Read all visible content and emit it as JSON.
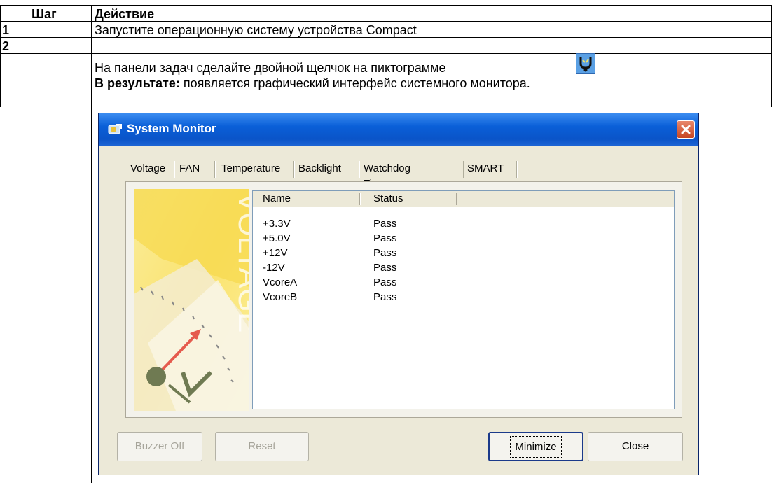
{
  "table": {
    "header": {
      "step": "Шаг",
      "action": "Действие"
    },
    "rows": [
      {
        "step": "1",
        "text": "Запустите операционную систему устройства Compact"
      },
      {
        "step": "2",
        "line1": "На панели задач сделайте двойной щелчок на пиктограмме",
        "result_label": "В результате:",
        "result_text": "появляется графический интерфейс системного монитора."
      }
    ]
  },
  "window": {
    "title": "System Monitor",
    "tabs": [
      "Voltage",
      "FAN",
      "Temperature",
      "Backlight",
      "Watchdog Timer",
      "SMART"
    ],
    "active_tab": "Voltage",
    "art_label": "VOLTAGE",
    "list": {
      "columns": [
        "Name",
        "Status"
      ],
      "rows": [
        {
          "name": "+3.3V",
          "status": "Pass"
        },
        {
          "name": "+5.0V",
          "status": "Pass"
        },
        {
          "name": "+12V",
          "status": "Pass"
        },
        {
          "name": "-12V",
          "status": "Pass"
        },
        {
          "name": "VcoreA",
          "status": "Pass"
        },
        {
          "name": "VcoreB",
          "status": "Pass"
        }
      ]
    },
    "buttons": {
      "buzzer_off": "Buzzer Off",
      "reset": "Reset",
      "minimize": "Minimize",
      "close": "Close"
    }
  },
  "icons": {
    "tray": "system-monitor-tray-icon",
    "title": "system-monitor-icon",
    "close": "close-icon"
  }
}
